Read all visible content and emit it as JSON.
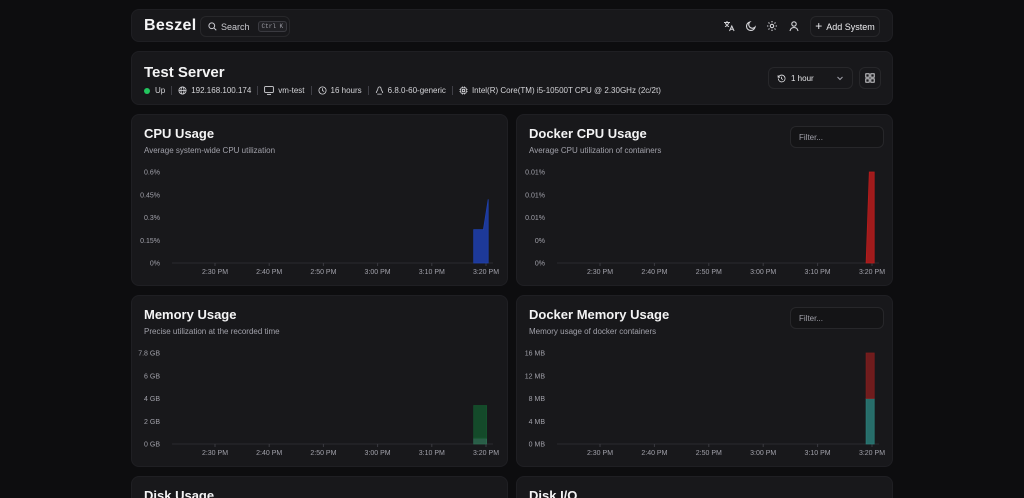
{
  "nav": {
    "logo": "Beszel",
    "search_label": "Search",
    "search_shortcut": "Ctrl K",
    "add_system_label": "Add System",
    "icons": [
      "translate-icon",
      "moon-icon",
      "gear-icon",
      "user-icon"
    ]
  },
  "header": {
    "server_name": "Test Server",
    "status": "Up",
    "status_color": "#22c55e",
    "ip": "192.168.100.174",
    "hostname": "vm-test",
    "uptime": "16 hours",
    "kernel": "6.8.0-60-generic",
    "cpu": "Intel(R) Core(TM) i5-10500T CPU @ 2.30GHz (2c/2t)",
    "time_range": "1 hour"
  },
  "cpu": {
    "title": "CPU Usage",
    "subtitle": "Average system-wide CPU utilization"
  },
  "docker_cpu": {
    "title": "Docker CPU Usage",
    "subtitle": "Average CPU utilization of containers",
    "filter_placeholder": "Filter..."
  },
  "memory": {
    "title": "Memory Usage",
    "subtitle": "Precise utilization at the recorded time"
  },
  "docker_memory": {
    "title": "Docker Memory Usage",
    "subtitle": "Memory usage of docker containers",
    "filter_placeholder": "Filter..."
  },
  "disk": {
    "title": "Disk Usage"
  },
  "disk_io": {
    "title": "Disk I/O"
  },
  "chart_data": [
    {
      "type": "area",
      "id": "cpu",
      "x_ticks": [
        "2:30 PM",
        "2:40 PM",
        "2:50 PM",
        "3:00 PM",
        "3:10 PM",
        "3:20 PM"
      ],
      "y_ticks": [
        "0%",
        "0.15%",
        "0.3%",
        "0.45%",
        "0.6%"
      ],
      "ylim": [
        0,
        0.6
      ],
      "series": [
        {
          "color": "#1e40af",
          "points": [
            [
              0.94,
              0
            ],
            [
              0.94,
              0.22
            ],
            [
              0.97,
              0.22
            ],
            [
              0.985,
              0.42
            ],
            [
              0.985,
              0
            ]
          ]
        }
      ]
    },
    {
      "type": "area",
      "id": "docker_cpu",
      "x_ticks": [
        "2:30 PM",
        "2:40 PM",
        "2:50 PM",
        "3:00 PM",
        "3:10 PM",
        "3:20 PM"
      ],
      "y_ticks": [
        "0%",
        "0%",
        "0.01%",
        "0.01%",
        "0.01%"
      ],
      "ylim": [
        0,
        0.02
      ],
      "series": [
        {
          "color": "#b91c1c",
          "points": [
            [
              0.96,
              0
            ],
            [
              0.97,
              0.02
            ],
            [
              0.985,
              0.02
            ],
            [
              0.985,
              0
            ]
          ]
        }
      ]
    },
    {
      "type": "area",
      "id": "memory",
      "x_ticks": [
        "2:30 PM",
        "2:40 PM",
        "2:50 PM",
        "3:00 PM",
        "3:10 PM",
        "3:20 PM"
      ],
      "y_ticks": [
        "0 GB",
        "2 GB",
        "4 GB",
        "6 GB",
        "7.8 GB"
      ],
      "ylim": [
        0,
        7.8
      ],
      "series": [
        {
          "color": "#2d6a4f",
          "points": [
            [
              0.94,
              0
            ],
            [
              0.94,
              0.5
            ],
            [
              0.98,
              0.5
            ],
            [
              0.98,
              0
            ]
          ]
        },
        {
          "color": "#14532d",
          "points": [
            [
              0.94,
              0.5
            ],
            [
              0.94,
              3.3
            ],
            [
              0.98,
              3.3
            ],
            [
              0.98,
              0.5
            ]
          ]
        }
      ]
    },
    {
      "type": "area",
      "id": "docker_memory",
      "x_ticks": [
        "2:30 PM",
        "2:40 PM",
        "2:50 PM",
        "3:00 PM",
        "3:10 PM",
        "3:20 PM"
      ],
      "y_ticks": [
        "0 MB",
        "4 MB",
        "8 MB",
        "12 MB",
        "16 MB"
      ],
      "ylim": [
        0,
        16
      ],
      "series": [
        {
          "color": "#2a7c78",
          "points": [
            [
              0.96,
              0
            ],
            [
              0.96,
              8
            ],
            [
              0.985,
              8
            ],
            [
              0.985,
              0
            ]
          ]
        },
        {
          "color": "#7f1d1d",
          "points": [
            [
              0.96,
              8
            ],
            [
              0.96,
              16
            ],
            [
              0.985,
              16
            ],
            [
              0.985,
              8
            ]
          ]
        }
      ]
    }
  ]
}
